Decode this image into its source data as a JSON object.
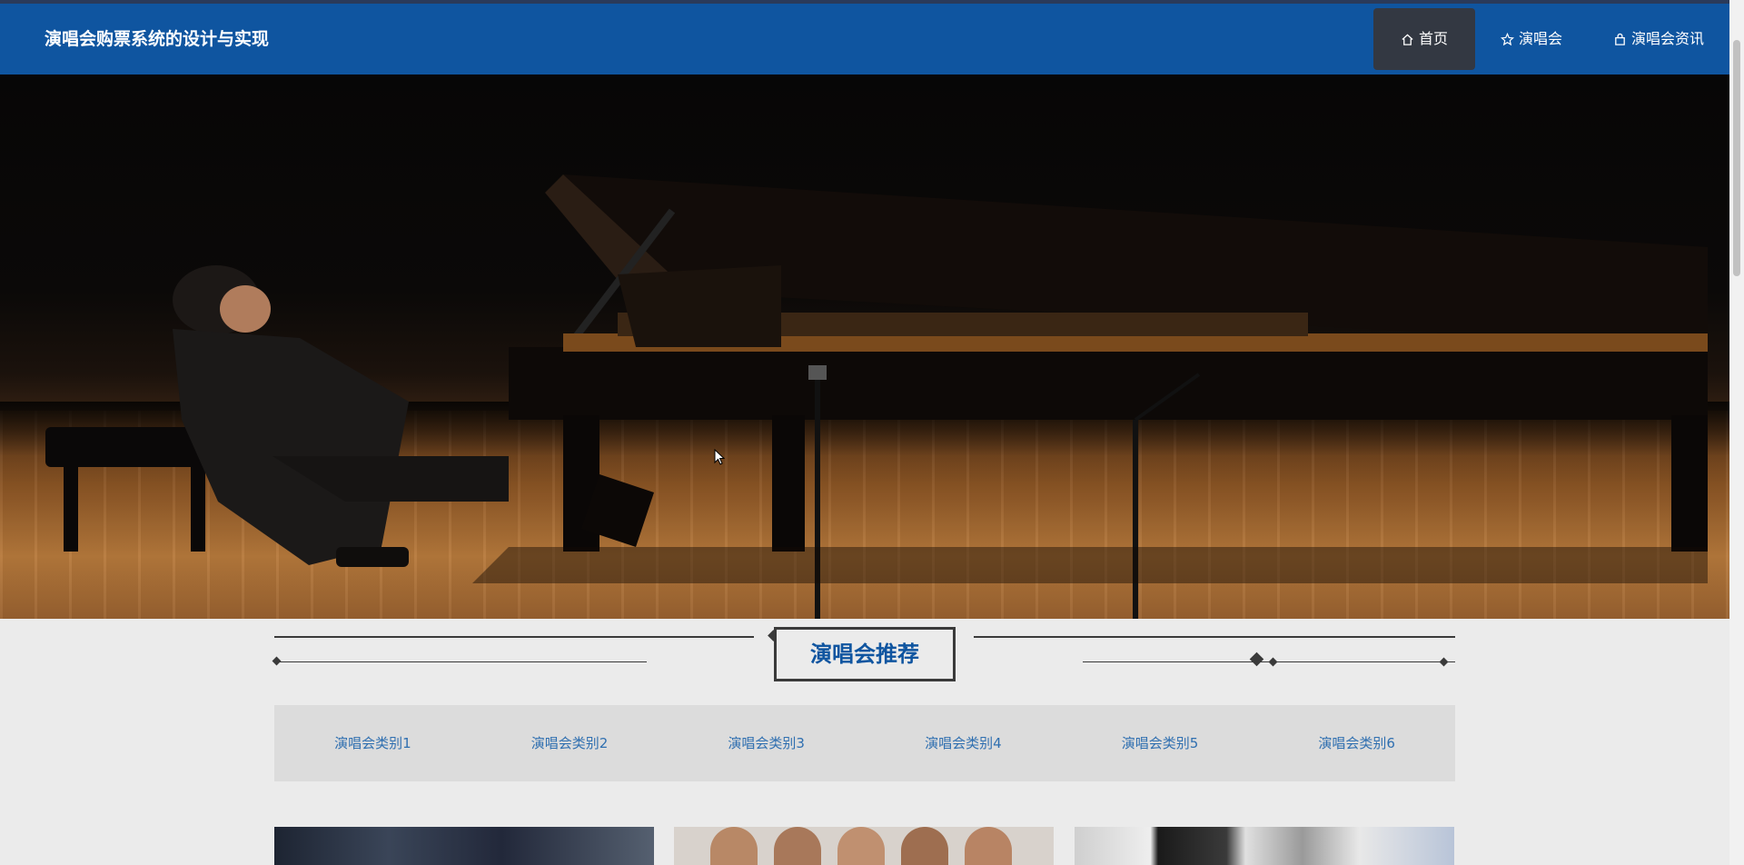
{
  "header": {
    "title": "演唱会购票系统的设计与实现",
    "nav": [
      {
        "label": "首页",
        "icon": "home-icon",
        "active": true
      },
      {
        "label": "演唱会",
        "icon": "star-icon",
        "active": false
      },
      {
        "label": "演唱会资讯",
        "icon": "bag-icon",
        "active": false
      }
    ]
  },
  "banner": {
    "slide_count": 1,
    "active_slide": 1
  },
  "recommend": {
    "title": "演唱会推荐",
    "categories": [
      "演唱会类别1",
      "演唱会类别2",
      "演唱会类别3",
      "演唱会类别4",
      "演唱会类别5",
      "演唱会类别6"
    ]
  },
  "colors": {
    "nav_bg": "#0f55a0",
    "nav_active_bg": "#333842",
    "accent_text": "#0f55a0",
    "category_text": "#2f6fb0",
    "page_bg": "#ebebeb"
  }
}
